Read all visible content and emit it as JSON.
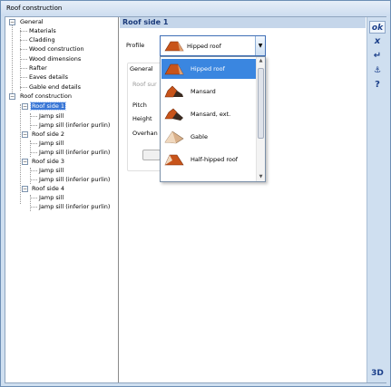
{
  "window": {
    "title": "Roof construction"
  },
  "tree": {
    "items": [
      {
        "label": "General",
        "level": 0,
        "expander": "−"
      },
      {
        "label": "Materials",
        "level": 1
      },
      {
        "label": "Cladding",
        "level": 1
      },
      {
        "label": "Wood construction",
        "level": 1
      },
      {
        "label": "Wood dimensions",
        "level": 1
      },
      {
        "label": "Rafter",
        "level": 1
      },
      {
        "label": "Eaves details",
        "level": 1
      },
      {
        "label": "Gable end details",
        "level": 1
      },
      {
        "label": "Roof construction",
        "level": 0,
        "expander": "−"
      },
      {
        "label": "Roof side 1",
        "level": 1,
        "expander": "−",
        "selected": true
      },
      {
        "label": "Jamp sill",
        "level": 2
      },
      {
        "label": "Jamp sill (inferior purlin)",
        "level": 2
      },
      {
        "label": "Roof side 2",
        "level": 1,
        "expander": "−"
      },
      {
        "label": "Jamp sill",
        "level": 2
      },
      {
        "label": "Jamp sill (inferior purlin)",
        "level": 2
      },
      {
        "label": "Roof side 3",
        "level": 1,
        "expander": "−"
      },
      {
        "label": "Jamp sill",
        "level": 2
      },
      {
        "label": "Jamp sill (inferior purlin)",
        "level": 2
      },
      {
        "label": "Roof side 4",
        "level": 1,
        "expander": "−"
      },
      {
        "label": "Jamp sill",
        "level": 2
      },
      {
        "label": "Jamp sill (inferior purlin)",
        "level": 2
      }
    ]
  },
  "panel": {
    "header": "Roof side 1",
    "profile_label": "Profile",
    "general_label": "General",
    "roof_surface_label": "Roof sur",
    "pitch_label": "Pitch",
    "height_label": "Height",
    "overhang_label": "Overhan"
  },
  "profile_combo": {
    "selected": "Hipped roof",
    "arrow": "▼",
    "options": [
      {
        "label": "Hipped roof",
        "highlighted": true,
        "icon": "hipped-roof-icon"
      },
      {
        "label": "Mansard",
        "icon": "mansard-roof-icon"
      },
      {
        "label": "Mansard, ext.",
        "icon": "mansard-ext-roof-icon"
      },
      {
        "label": "Gable",
        "icon": "gable-roof-icon"
      },
      {
        "label": "Half-hipped roof",
        "icon": "half-hipped-roof-icon"
      }
    ]
  },
  "toolbar": {
    "ok": "ok",
    "cancel": "x",
    "enter": "↵",
    "anchor": "⚓",
    "help": "?",
    "view3d": "3D"
  },
  "colors": {
    "accent": "#3a86e0",
    "header_bg": "#c5d6ea",
    "roof_orange": "#c8541a",
    "gable_tan": "#d9b08a",
    "toolbar_text": "#1b3f8a"
  }
}
